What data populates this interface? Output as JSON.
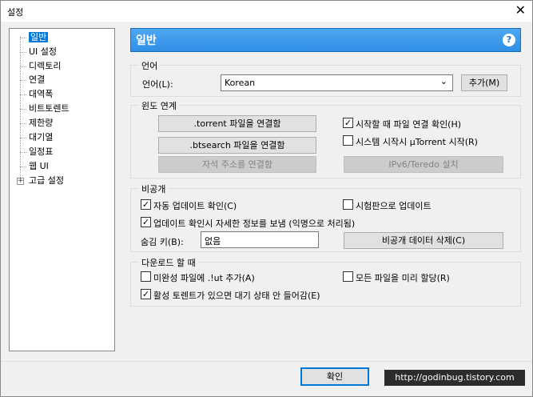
{
  "window": {
    "title": "설정",
    "close_glyph": "✕"
  },
  "sidebar": {
    "items": [
      {
        "label": "일반",
        "selected": true
      },
      {
        "label": "UI 설정"
      },
      {
        "label": "디렉토리"
      },
      {
        "label": "연결"
      },
      {
        "label": "대역폭"
      },
      {
        "label": "비트토렌트"
      },
      {
        "label": "제한량"
      },
      {
        "label": "대기열"
      },
      {
        "label": "일정표"
      },
      {
        "label": "웹 UI"
      },
      {
        "label": "고급 설정",
        "expander": "+"
      }
    ]
  },
  "header": {
    "title": "일반",
    "help_glyph": "?"
  },
  "language": {
    "group_title": "언어",
    "label": "언어(L):",
    "value": "Korean",
    "add_button": "추가(M)"
  },
  "windows": {
    "group_title": "윈도 연계",
    "torrent_button": ".torrent 파일을 연결함",
    "btsearch_button": ".btsearch 파일을 연결함",
    "magnet_button": "자석 주소를 연결함",
    "check_on_start": {
      "label": "시작할 때 파일 연결 확인(H)",
      "checked": true
    },
    "start_on_boot": {
      "label": "시스템 시작시 µTorrent 시작(R)",
      "checked": false
    },
    "ipv6_button": "IPv6/Teredo 설치"
  },
  "privacy": {
    "group_title": "비공개",
    "auto_update": {
      "label": "자동 업데이트 확인(C)",
      "checked": true
    },
    "beta_update": {
      "label": "시험판으로 업데이트",
      "checked": false
    },
    "send_info": {
      "label": "업데이트 확인시 자세한 정보를 보냄 (익명으로 처리됨)",
      "checked": true
    },
    "boss_key_label": "숨김 키(B):",
    "boss_key_value": "없음",
    "delete_button": "비공개 데이터 삭제(C)"
  },
  "download": {
    "group_title": "다운로드 할 때",
    "append_ut": {
      "label": "미완성 파일에 .!ut 추가(A)",
      "checked": false
    },
    "prealloc": {
      "label": "모든 파일을 미리 할당(R)",
      "checked": false
    },
    "prevent_standby": {
      "label": "활성 토렌트가 있으면 대기 상태 안 들어감(E)",
      "checked": true
    }
  },
  "footer": {
    "ok_button": "확인",
    "watermark": "http://godinbug.tistory.com"
  },
  "check_glyph": "✓"
}
